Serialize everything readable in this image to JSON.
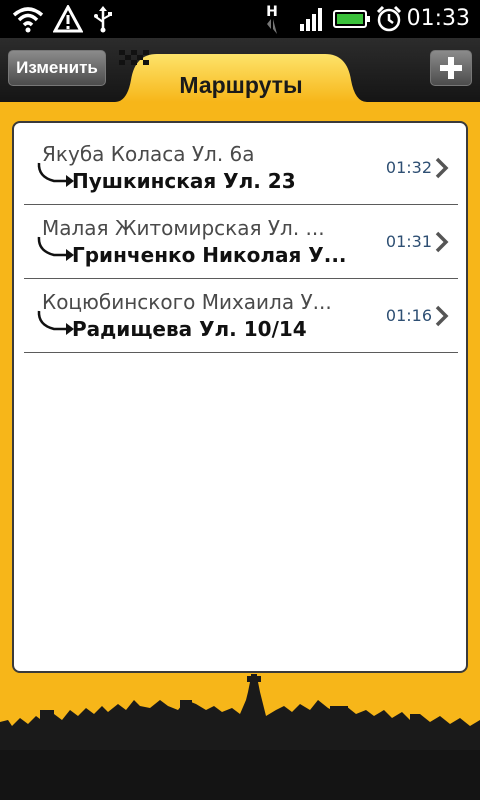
{
  "status_bar": {
    "time": "01:33",
    "network_type": "H",
    "icons": [
      "wifi-icon",
      "warning-icon",
      "usb-icon",
      "h-network-icon",
      "signal-icon",
      "battery-icon",
      "alarm-icon"
    ]
  },
  "header": {
    "edit_label": "Изменить",
    "title": "Маршруты",
    "add_icon": "plus-icon"
  },
  "routes": [
    {
      "from": "Якуба Коласа Ул. 6а",
      "to": "Пушкинская Ул. 23",
      "time": "01:32"
    },
    {
      "from": "Малая Житомирская Ул. ...",
      "to": "Гринченко Николая У...",
      "time": "01:31"
    },
    {
      "from": "Коцюбинского Михаила У...",
      "to": "Радищева Ул. 10/14",
      "time": "01:16"
    }
  ],
  "colors": {
    "brand_yellow": "#f7b619",
    "time_blue": "#2e4f73",
    "header_dark": "#1e1e1e"
  }
}
